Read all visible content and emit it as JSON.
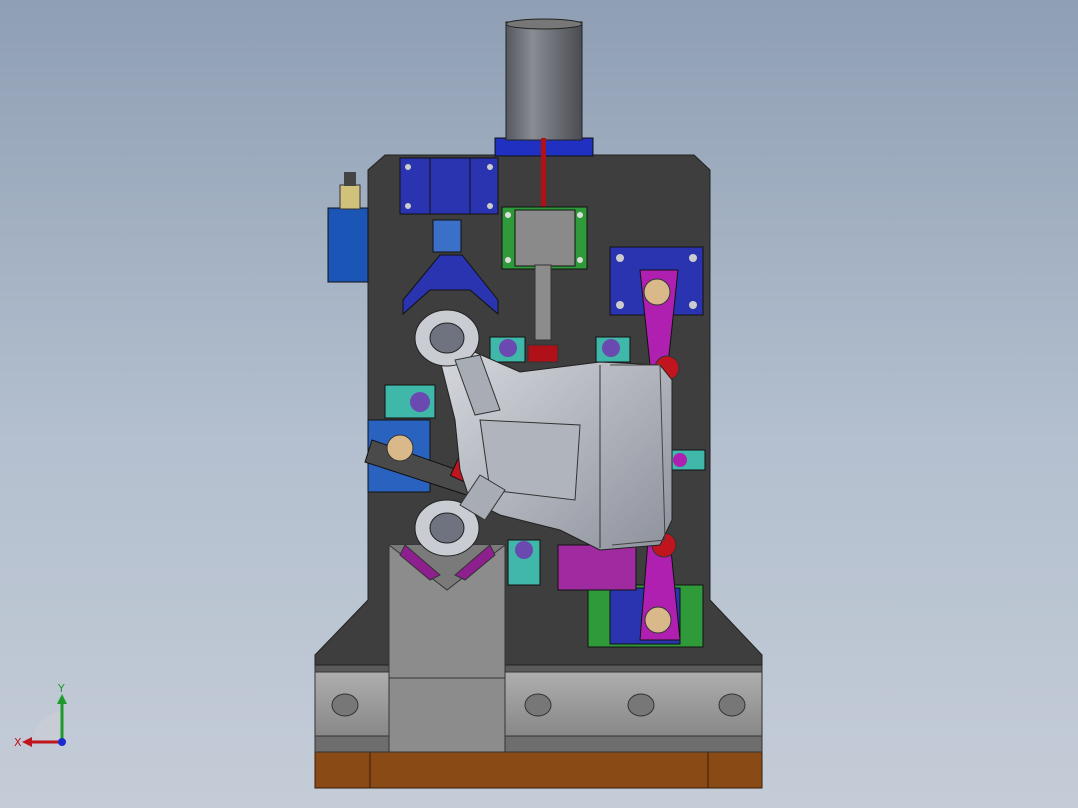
{
  "viewport": {
    "background_top": "#8f9fb4",
    "background_bottom": "#c4ccd7"
  },
  "model": {
    "description_colors": {
      "base_plate": "#3e3e3e",
      "wood_base": "#8a4a16",
      "steel": "#9a9a9a",
      "part": "#b9bcc4",
      "blue_block": "#2a34b0",
      "green_block": "#2f9a3a",
      "magenta_clamp": "#b020b0",
      "red": "#c0141e",
      "teal": "#3fb7a9",
      "cylinder": "#6d6f77"
    }
  },
  "triad": {
    "x_label": "X",
    "y_label": "Y",
    "x_color": "#c0141e",
    "y_color": "#1e9a2a",
    "z_color": "#1a2bd0"
  }
}
